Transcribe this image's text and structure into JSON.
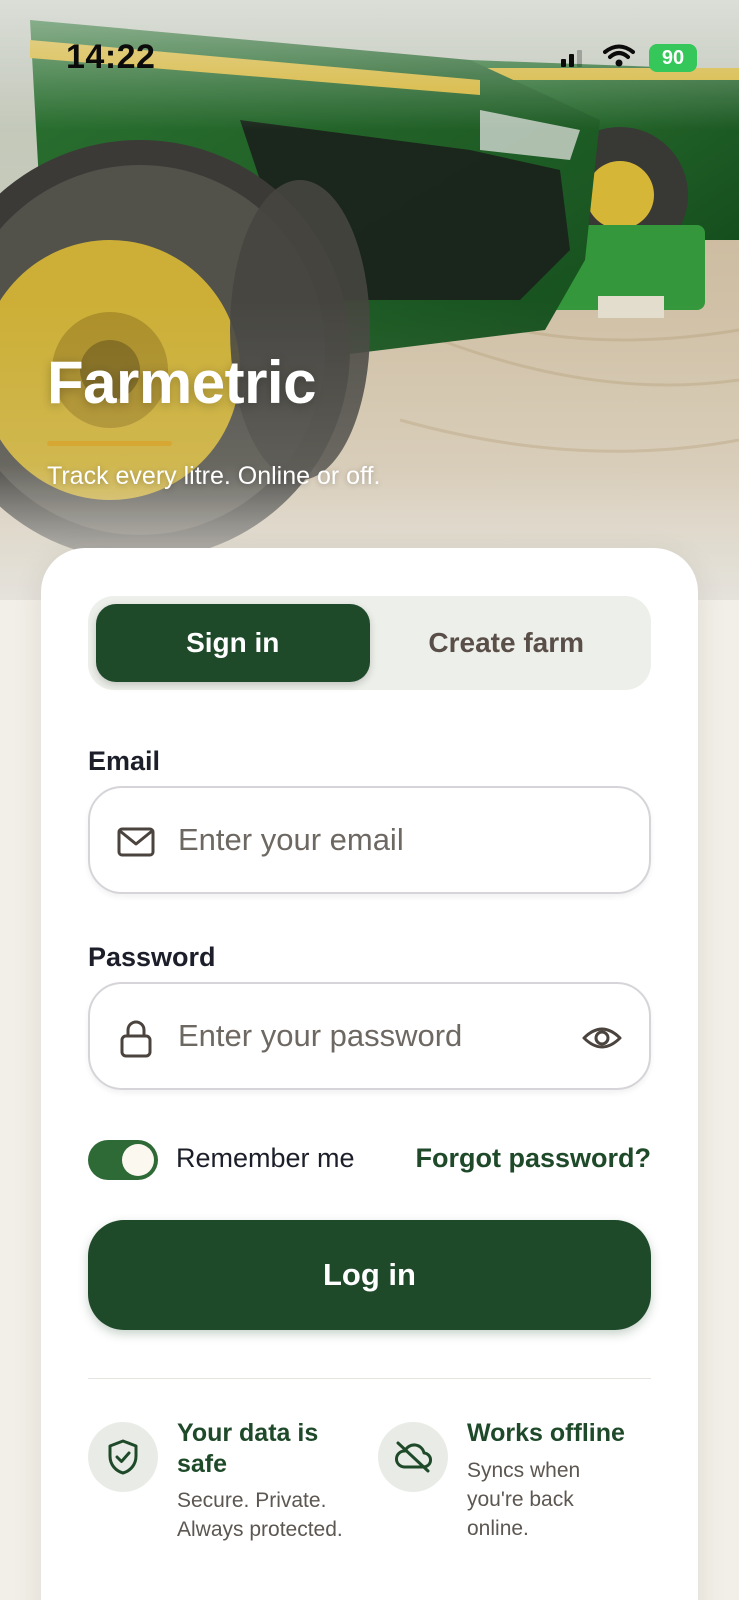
{
  "status_bar": {
    "time": "14:22",
    "battery": "90"
  },
  "brand": {
    "name": "Farmetric",
    "tagline": "Track every litre. Online or off.",
    "accent": "#d7a733"
  },
  "tabs": [
    {
      "label": "Sign in",
      "active": true
    },
    {
      "label": "Create farm",
      "active": false
    }
  ],
  "email": {
    "label": "Email",
    "placeholder": "Enter your email",
    "icon": "mail-icon"
  },
  "password": {
    "label": "Password",
    "placeholder": "Enter your password",
    "icon": "lock-icon",
    "toggle_icon": "eye-icon"
  },
  "remember": {
    "label": "Remember me",
    "checked": true
  },
  "forgot_label": "Forgot password?",
  "login_label": "Log in",
  "features": [
    {
      "icon": "shield-check-icon",
      "title": "Your data is safe",
      "desc": "Secure. Private. Always protected."
    },
    {
      "icon": "cloud-off-icon",
      "title": "Works offline",
      "desc": "Syncs when you're back online."
    }
  ],
  "colors": {
    "primary": "#1f4a2a",
    "background": "#f2efe8",
    "toggle_on": "#2e6a36"
  }
}
